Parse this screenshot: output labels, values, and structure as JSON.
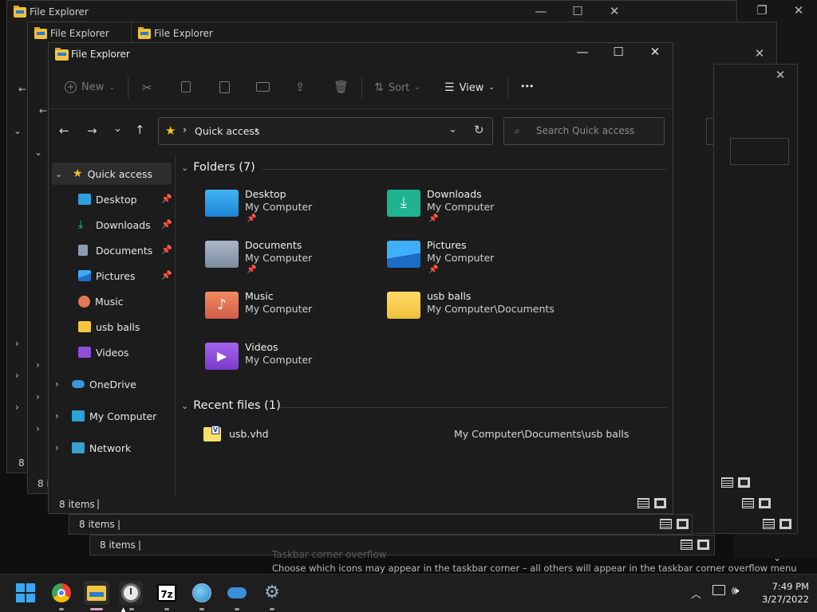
{
  "window": {
    "title": "File Explorer"
  },
  "background_windows": {
    "titles": [
      "File Explorer",
      "File Explorer",
      "File Explorer"
    ],
    "status_counts": [
      "8 i",
      "8 i",
      "8 items",
      "8 items"
    ]
  },
  "settings_ghost": {
    "heading": "Taskbar corner overflow",
    "description": "Choose which icons may appear in the taskbar corner – all others will appear in the taskbar corner overflow menu"
  },
  "toolbar": {
    "new_label": "New",
    "sort_label": "Sort",
    "view_label": "View",
    "more_label": "•••"
  },
  "address": {
    "crumb": "Quick access",
    "separator": "›"
  },
  "search": {
    "placeholder": "Search Quick access"
  },
  "sidebar": {
    "quick_access": "Quick access",
    "pinned": [
      {
        "label": "Desktop",
        "pinned": true
      },
      {
        "label": "Downloads",
        "pinned": true
      },
      {
        "label": "Documents",
        "pinned": true
      },
      {
        "label": "Pictures",
        "pinned": true
      },
      {
        "label": "Music",
        "pinned": false
      },
      {
        "label": "usb balls",
        "pinned": false
      },
      {
        "label": "Videos",
        "pinned": false
      }
    ],
    "roots": [
      "OneDrive",
      "My Computer",
      "Network"
    ]
  },
  "folders_section": {
    "heading": "Folders (7)",
    "items": [
      {
        "name": "Desktop",
        "location": "My Computer",
        "pinned": true,
        "icon": "desktop-folder-icon"
      },
      {
        "name": "Downloads",
        "location": "My Computer",
        "pinned": true,
        "icon": "downloads-folder-icon"
      },
      {
        "name": "Documents",
        "location": "My Computer",
        "pinned": true,
        "icon": "documents-folder-icon"
      },
      {
        "name": "Pictures",
        "location": "My Computer",
        "pinned": true,
        "icon": "pictures-folder-icon"
      },
      {
        "name": "Music",
        "location": "My Computer",
        "pinned": false,
        "icon": "music-folder-icon"
      },
      {
        "name": "usb balls",
        "location": "My Computer\\Documents",
        "pinned": false,
        "icon": "folder-icon"
      },
      {
        "name": "Videos",
        "location": "My Computer",
        "pinned": false,
        "icon": "videos-folder-icon"
      }
    ]
  },
  "recent_section": {
    "heading": "Recent files (1)",
    "items": [
      {
        "name": "usb.vhd",
        "path": "My Computer\\Documents\\usb balls",
        "icon": "vhd-file-icon"
      }
    ]
  },
  "statusbar": {
    "count": "8 items",
    "divider": "|"
  },
  "taskbar": {
    "apps": [
      "start-icon",
      "chrome-icon",
      "file-explorer-icon",
      "clock-app-icon",
      "7zip-icon",
      "globe-app-icon",
      "cloud-app-icon",
      "settings-icon"
    ],
    "sevenzip_label": "7z",
    "time": "7:49 PM",
    "date": "3/27/2022"
  },
  "colors": {
    "accent_blue": "#2b7bd3",
    "folder_yellow": "#f3c640",
    "background": "#1c1c1c"
  }
}
